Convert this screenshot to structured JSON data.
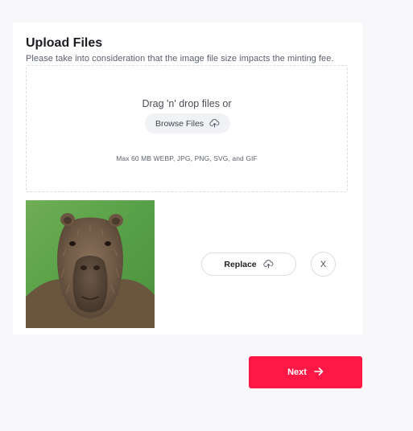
{
  "upload": {
    "title": "Upload Files",
    "subtitle": "Please take into consideration that the image file size impacts the minting fee.",
    "dropzone": {
      "drag_text": "Drag 'n' drop files or",
      "browse_label": "Browse Files",
      "browse_icon": "cloud-upload-icon",
      "limits_text": "Max 60 MB WEBP, JPG, PNG, SVG, and GIF"
    },
    "preview": {
      "image_subject": "capybara"
    },
    "replace_label": "Replace",
    "replace_icon": "cloud-upload-icon",
    "remove_label": "X"
  },
  "footer": {
    "next_label": "Next",
    "next_icon": "arrow-right-icon",
    "accent_color": "#ff1745"
  }
}
